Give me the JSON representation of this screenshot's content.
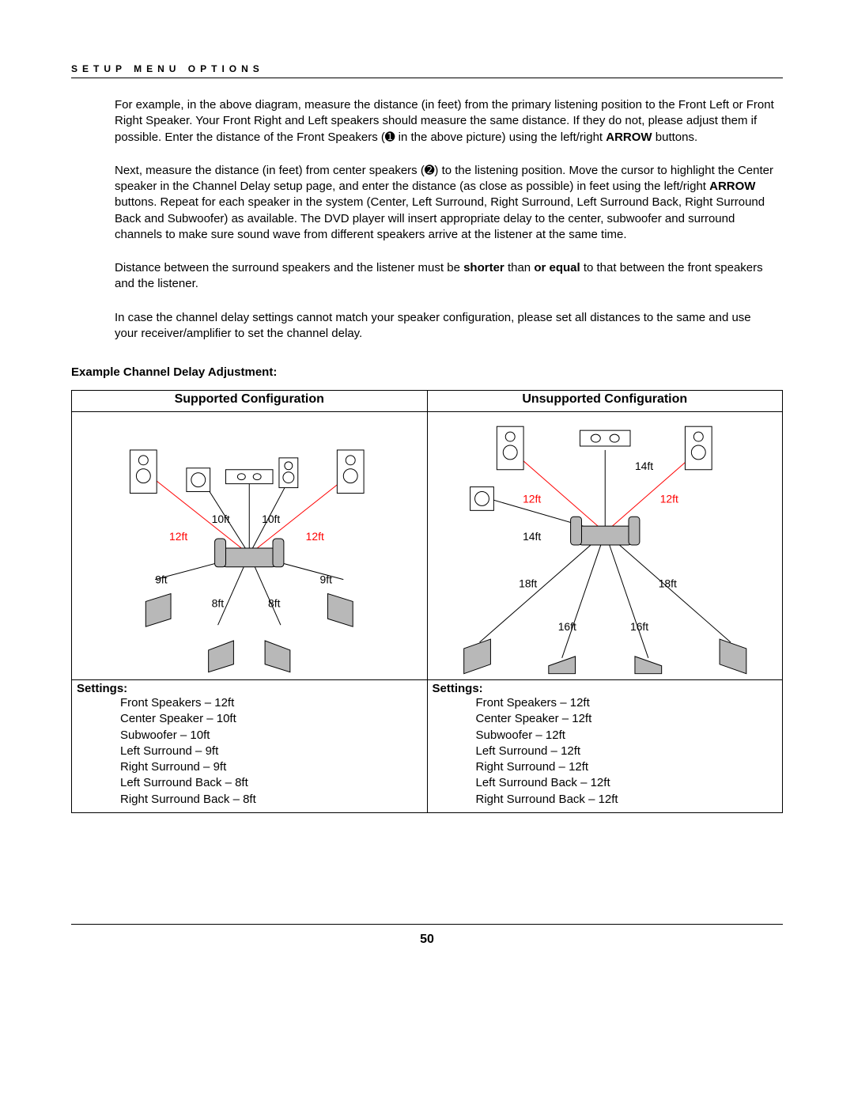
{
  "running_head": "SETUP MENU OPTIONS",
  "paragraphs": {
    "p1a": "For example, in the above diagram, measure the distance (in feet) from the primary listening position to the Front Left or Front Right Speaker. Your Front Right and Left speakers should measure the same distance. If they do not, please adjust them if possible. Enter the distance of the Front Speakers (",
    "p1b": " in the above picture) using the left/right ",
    "p1c": " buttons.",
    "arrow": "ARROW",
    "p2a": "Next, measure the distance (in feet) from center speakers (",
    "p2b": ") to the listening position. Move the cursor to highlight the Center speaker in the Channel Delay setup page, and enter the distance (as close as possible) in feet using the left/right ",
    "p2c": " buttons. Repeat for each speaker in the system (Center, Left Surround, Right Surround, Left Surround Back, Right Surround Back and Subwoofer) as available. The DVD player will insert appropriate delay to the center, subwoofer and surround channels to make sure sound wave from different speakers arrive at the listener at the same time.",
    "p3a": "Distance between the surround speakers and the listener must be ",
    "p3b": "shorter",
    "p3c": " than ",
    "p3d": "or equal",
    "p3e": " to that between the front speakers and the listener.",
    "p4": "In case the channel delay settings cannot match your speaker configuration, please set all distances to the same and use your receiver/amplifier to set the channel delay."
  },
  "icons": {
    "one": "➊",
    "two": "➋"
  },
  "example_heading": "Example Channel Delay Adjustment:",
  "table": {
    "head_left": "Supported Configuration",
    "head_right": "Unsupported Configuration",
    "settings_label": "Settings:",
    "left_list": [
      "Front Speakers – 12ft",
      "Center Speaker – 10ft",
      "Subwoofer – 10ft",
      "Left Surround – 9ft",
      "Right Surround – 9ft",
      "Left Surround Back – 8ft",
      "Right Surround Back – 8ft"
    ],
    "right_list": [
      "Front Speakers – 12ft",
      "Center Speaker – 12ft",
      "Subwoofer – 12ft",
      "Left Surround – 12ft",
      "Right Surround – 12ft",
      "Left Surround  Back – 12ft",
      "Right Surround Back – 12ft"
    ]
  },
  "diagram_left": {
    "front_left": "12ft",
    "front_right": "12ft",
    "center_left": "10ft",
    "center_right": "10ft",
    "surround_left": "9ft",
    "surround_right": "9ft",
    "back_left": "8ft",
    "back_right": "8ft"
  },
  "diagram_right": {
    "center_top": "14ft",
    "front_left": "12ft",
    "front_right": "12ft",
    "sub": "14ft",
    "surround_left": "18ft",
    "surround_right": "18ft",
    "back_left": "16ft",
    "back_right": "16ft"
  },
  "page_number": "50"
}
